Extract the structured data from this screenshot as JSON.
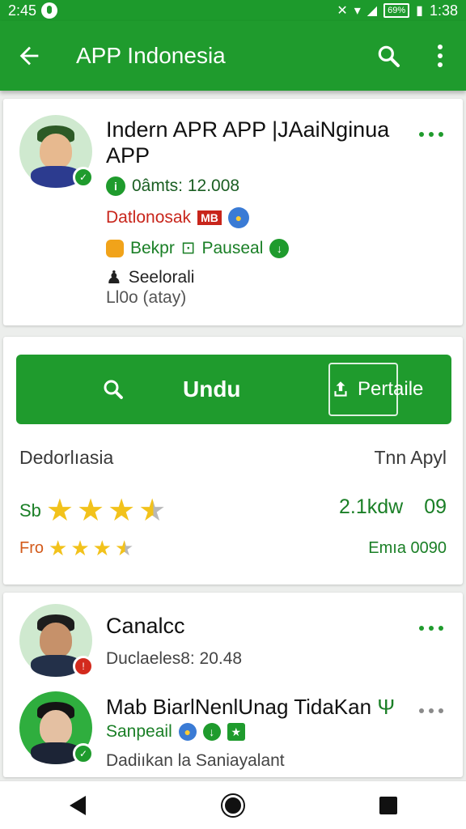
{
  "status_bar": {
    "time": "2:45",
    "right_time": "1:38",
    "battery": "69%"
  },
  "appbar": {
    "title": "APP Indonesia",
    "back_icon": "arrow-left-icon",
    "search_icon": "search-icon",
    "menu_icon": "more-vert-icon"
  },
  "profile": {
    "name": "Indern APR APP |JAaiNginua APP",
    "stat": "0âmts: 12.008",
    "download_text": "Datlonosak",
    "download_tag": "MB",
    "badge_text": "Bekpr",
    "badge_mid": "Pauseal",
    "category": "Seelorali",
    "category_sub": "Ll0o (atay)"
  },
  "actions": {
    "main_label": "Undu",
    "share_label": "Pertaile",
    "left_caption": "Dedorlıasia",
    "right_caption": "Tnn Apyl"
  },
  "ratings": [
    {
      "label": "Sb",
      "stars": 3.5,
      "count": "2.1kdw",
      "score": "09"
    },
    {
      "label": "Fro",
      "stars": 3.5,
      "count": "Emıa 0090",
      "score": ""
    }
  ],
  "entries": [
    {
      "title": "Canalcc",
      "sub": "Duclaeles8: 20.48",
      "badge": "red"
    },
    {
      "title": "Mab BiarlNenlUnag TidaKan",
      "sub": "Sanpeail",
      "sub2": "Dadiıkan la Saniayalant",
      "badge": "green"
    }
  ],
  "colors": {
    "primary": "#1f9b2d",
    "accent_red": "#c8251b",
    "star": "#f2c21b"
  }
}
